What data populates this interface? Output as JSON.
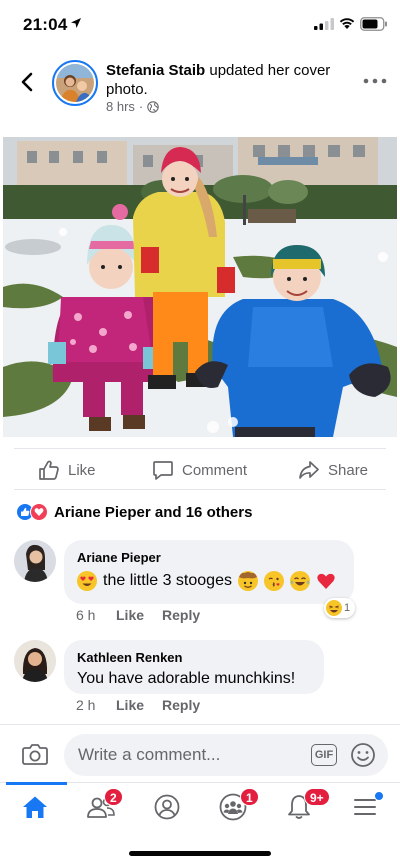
{
  "status_bar": {
    "time": "21:04"
  },
  "post": {
    "author": "Stefania Staib",
    "action_text": " updated her cover photo.",
    "time": "8 hrs",
    "privacy_icon": "globe-icon"
  },
  "actions": {
    "like": "Like",
    "comment": "Comment",
    "share": "Share"
  },
  "reactions": {
    "summary": "Ariane Pieper and 16 others",
    "types": [
      "like",
      "love"
    ]
  },
  "comments": [
    {
      "name": "Ariane Pieper",
      "text_before": "the little 3 stooges",
      "emojis_leading": [
        "heart-eyes-emoji"
      ],
      "emojis_trailing": [
        "cowboy-emoji",
        "kiss-emoji",
        "tears-of-joy-emoji",
        "red-heart-emoji"
      ],
      "time": "6 h",
      "like": "Like",
      "reply": "Reply",
      "reaction": {
        "icon": "haha-emoji",
        "count": "1"
      }
    },
    {
      "name": "Kathleen Renken",
      "text": "You have adorable munchkins!",
      "time": "2 h",
      "like": "Like",
      "reply": "Reply"
    }
  ],
  "composer": {
    "placeholder": "Write a comment...",
    "gif": "GIF"
  },
  "tabs": {
    "home": {
      "icon": "home-icon"
    },
    "friends": {
      "icon": "friends-icon",
      "badge": "2"
    },
    "profile": {
      "icon": "profile-icon"
    },
    "groups": {
      "icon": "groups-icon",
      "badge": "1"
    },
    "notifications": {
      "icon": "bell-icon",
      "badge": "9+"
    },
    "menu": {
      "icon": "menu-icon"
    }
  },
  "colors": {
    "brand_blue": "#1877f2",
    "badge_red": "#e41e3f",
    "secondary_text": "#65676b",
    "bubble_bg": "#f0f2f5"
  }
}
